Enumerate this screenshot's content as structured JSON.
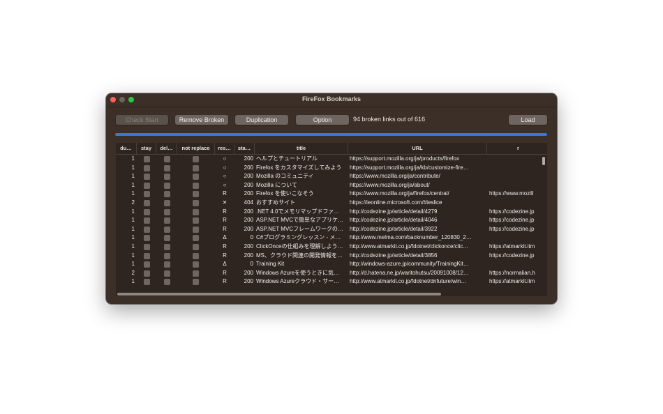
{
  "window": {
    "title": "FireFox Bookmarks"
  },
  "toolbar": {
    "check_start": "Check Start",
    "remove_broken": "Remove Broken",
    "duplication": "Duplication",
    "option": "Option",
    "status": "94 broken links out of 616",
    "load": "Load"
  },
  "progress": {
    "fraction": 1.0,
    "color": "#2f7bd8"
  },
  "table": {
    "columns": [
      "du…",
      "stay",
      "del…",
      "not replace",
      "res…",
      "sta…",
      "title",
      "URL",
      "r"
    ],
    "rows": [
      {
        "dup": "1",
        "res": "○",
        "status": "200",
        "title": "ヘルプとチュートリアル",
        "url": "https://support.mozilla.org/ja/products/firefox",
        "redirect": ""
      },
      {
        "dup": "1",
        "res": "○",
        "status": "200",
        "title": "Firefox をカスタマイズしてみよう",
        "url": "https://support.mozilla.org/ja/kb/customize-fire…",
        "redirect": ""
      },
      {
        "dup": "1",
        "res": "○",
        "status": "200",
        "title": "Mozilla のコミュニティ",
        "url": "https://www.mozilla.org/ja/contribute/",
        "redirect": ""
      },
      {
        "dup": "1",
        "res": "○",
        "status": "200",
        "title": "Mozilla について",
        "url": "https://www.mozilla.org/ja/about/",
        "redirect": ""
      },
      {
        "dup": "1",
        "res": "R",
        "status": "200",
        "title": "Firefox を使いこなそう",
        "url": "https://www.mozilla.org/ja/firefox/central/",
        "redirect": "https://www.mozill"
      },
      {
        "dup": "2",
        "res": "✕",
        "status": "404",
        "title": "おすすめサイト",
        "url": "https://ieonline.microsoft.com/#ieslice",
        "redirect": ""
      },
      {
        "dup": "1",
        "res": "R",
        "status": "200",
        "title": ".NET 4.0でメモリマップドファ…",
        "url": "http://codezine.jp/article/detail/4279",
        "redirect": "https://codezine.jp"
      },
      {
        "dup": "1",
        "res": "R",
        "status": "200",
        "title": "ASP.NET MVCで簡単なアプリケ…",
        "url": "http://codezine.jp/article/detail/4046",
        "redirect": "https://codezine.jp"
      },
      {
        "dup": "1",
        "res": "R",
        "status": "200",
        "title": "ASP.NET MVCフレームワークの…",
        "url": "http://codezine.jp/article/detail/3922",
        "redirect": "https://codezine.jp"
      },
      {
        "dup": "1",
        "res": "Δ",
        "status": "0",
        "title": "C#プログラミングレッスン - メ…",
        "url": "http://www.melma.com/backnumber_120830_2…",
        "redirect": ""
      },
      {
        "dup": "1",
        "res": "R",
        "status": "200",
        "title": "ClickOnceの仕組みを理解しよう…",
        "url": "http://www.atmarkit.co.jp/fdotnet/clickonce/clic…",
        "redirect": "https://atmarkit.itm"
      },
      {
        "dup": "1",
        "res": "R",
        "status": "200",
        "title": "MS、クラウド関連の開発情報を…",
        "url": "http://codezine.jp/article/detail/3856",
        "redirect": "https://codezine.jp"
      },
      {
        "dup": "1",
        "res": "Δ",
        "status": "0",
        "title": "Training Kit",
        "url": "http://windows-azure.jp/community/TrainingKit…",
        "redirect": ""
      },
      {
        "dup": "2",
        "res": "R",
        "status": "200",
        "title": "Windows Azureを使うときに気…",
        "url": "http://d.hatena.ne.jp/waritohutsu/20091008/12…",
        "redirect": "https://normalian.h"
      },
      {
        "dup": "1",
        "res": "R",
        "status": "200",
        "title": "Windows Azureクラウド・サー…",
        "url": "http://www.atmarkit.co.jp/fdotnet/dnfuture/win…",
        "redirect": "https://atmarkit.itm"
      }
    ]
  }
}
